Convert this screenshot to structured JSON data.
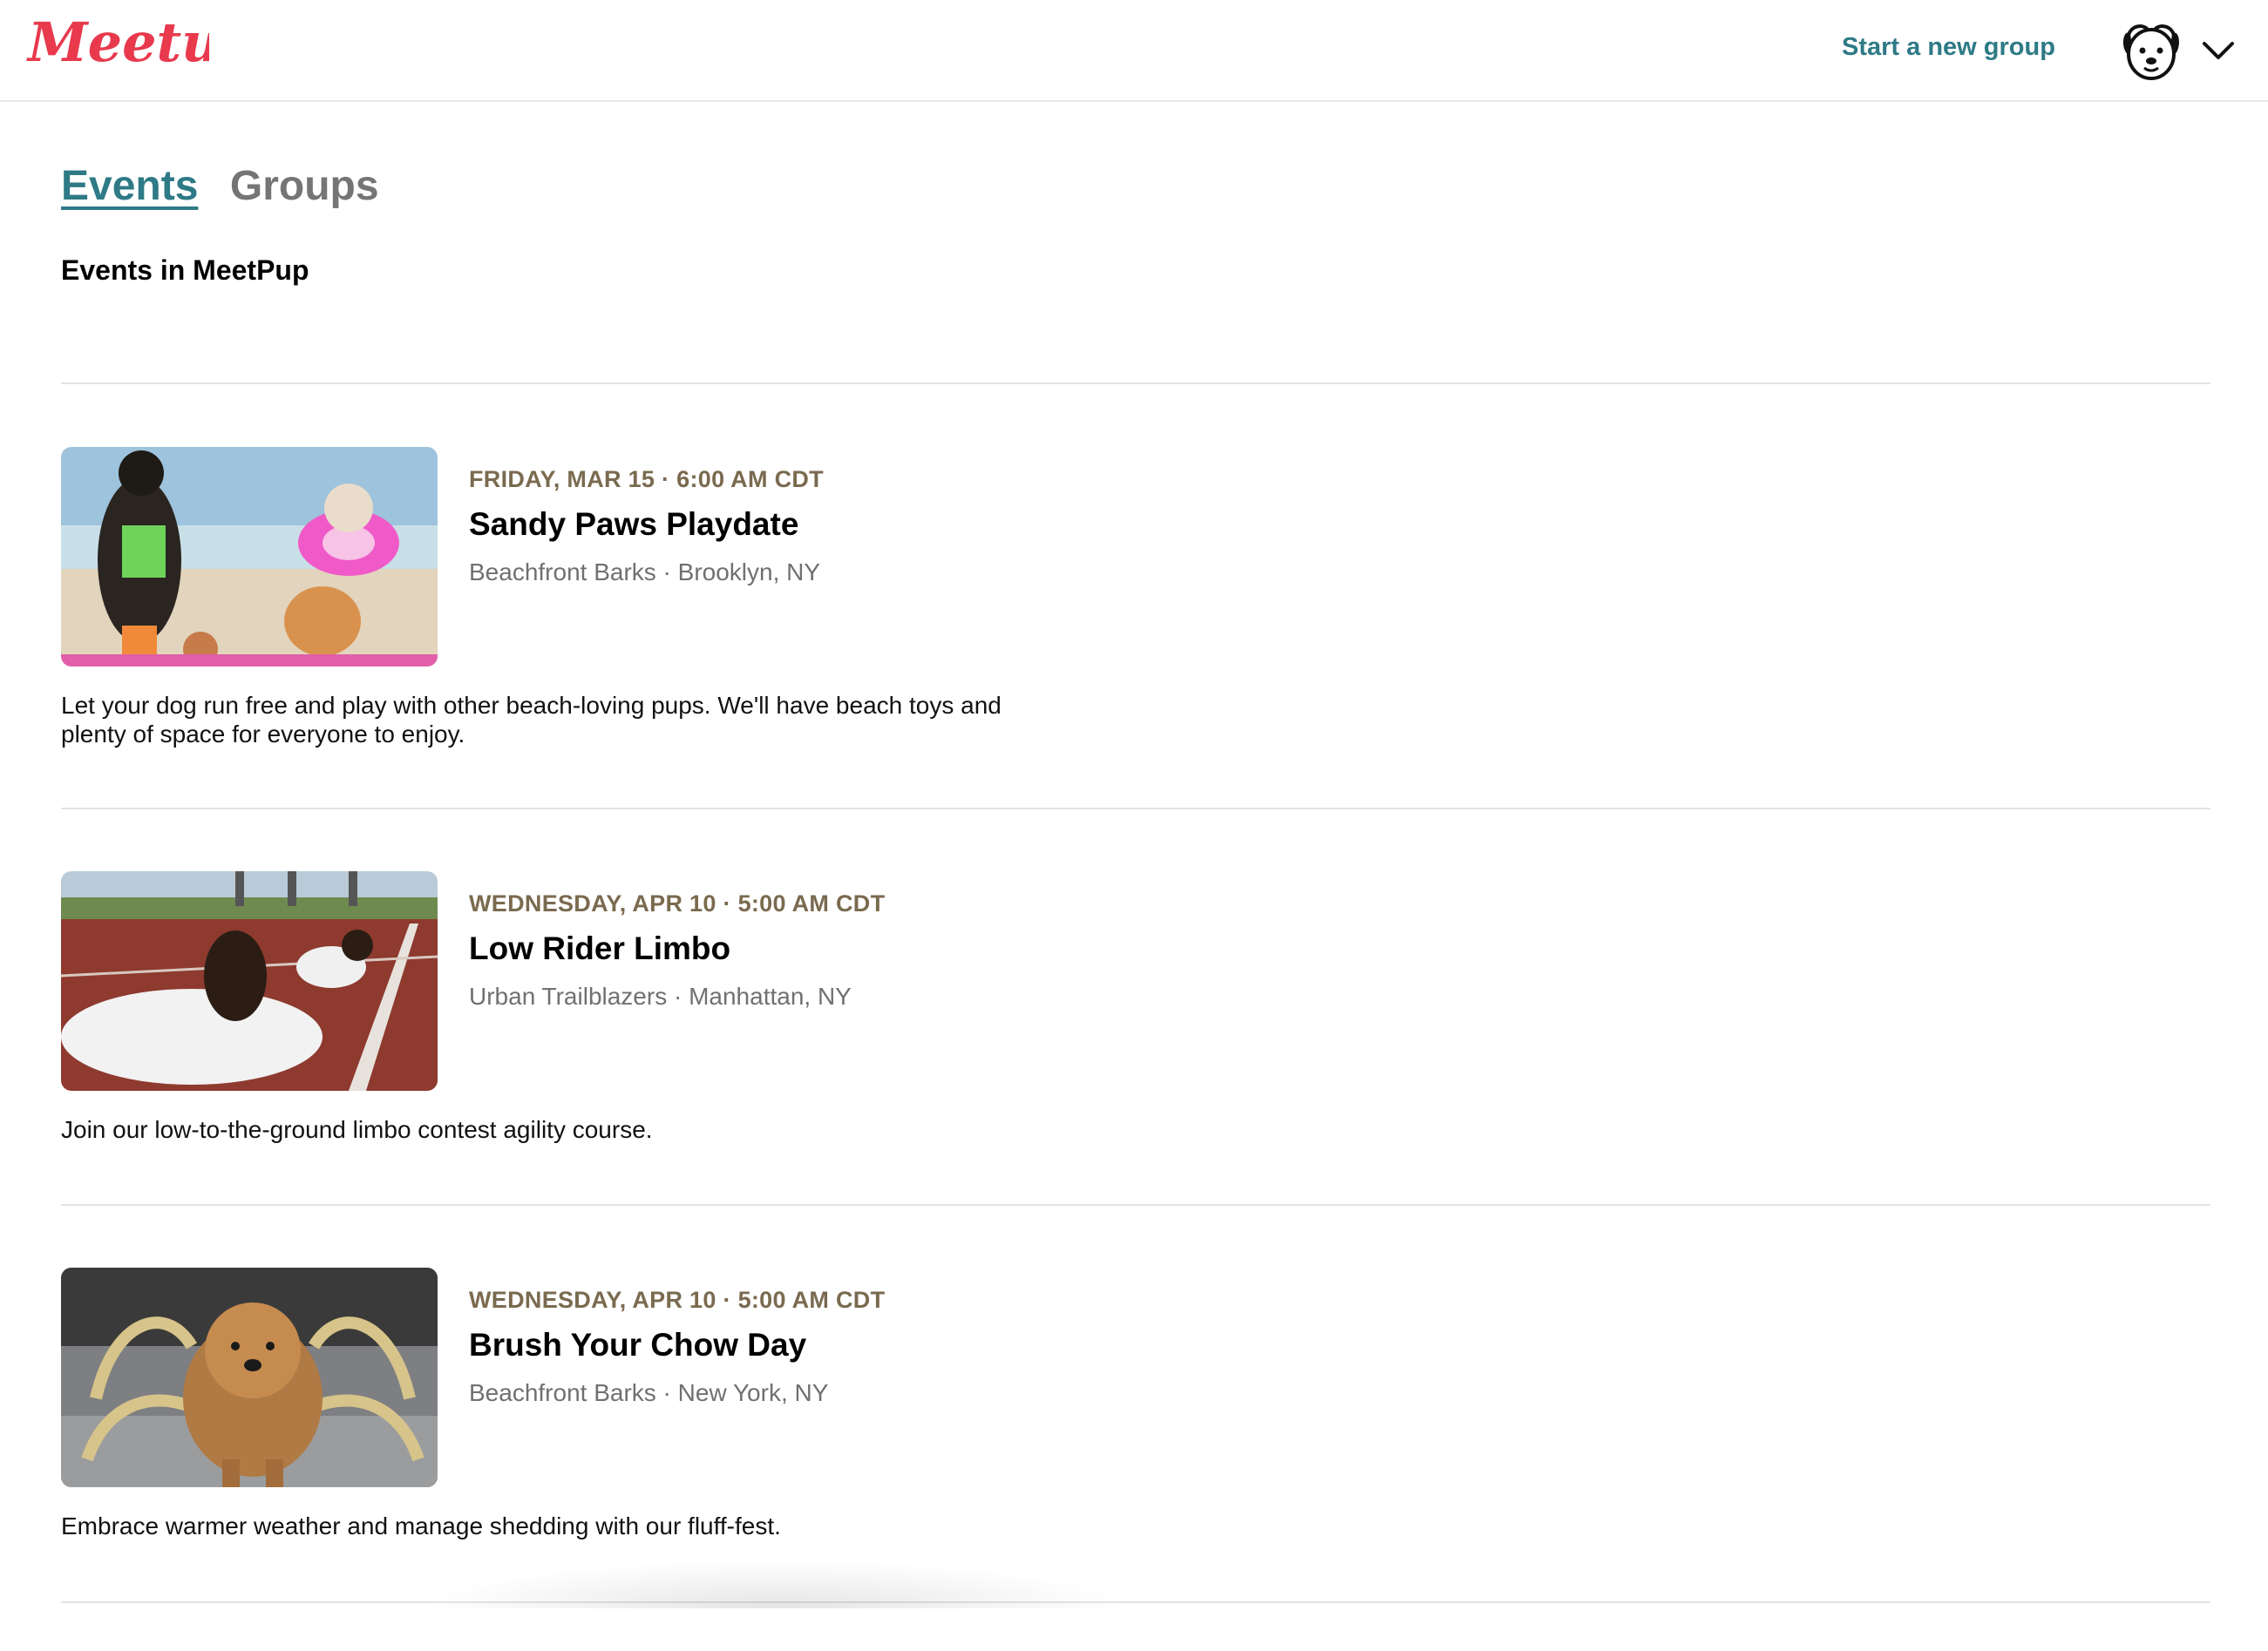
{
  "header": {
    "logo_text": "Meetup",
    "new_group_label": "Start a new group",
    "avatar_icon": "dog-face-icon",
    "menu_icon": "chevron-down-icon"
  },
  "tabs": [
    {
      "label": "Events",
      "active": true
    },
    {
      "label": "Groups",
      "active": false
    }
  ],
  "section_title": "Events in MeetPup",
  "events": [
    {
      "date": "FRIDAY, MAR 15 · 6:00 AM CDT",
      "title": "Sandy Paws Playdate",
      "location": "Beachfront Barks · Brooklyn, NY",
      "description": "Let your dog run free and play with other beach-loving pups. We'll have beach toys and plenty of space for everyone to enjoy."
    },
    {
      "date": "WEDNESDAY, APR 10 · 5:00 AM CDT",
      "title": "Low Rider Limbo",
      "location": "Urban Trailblazers · Manhattan, NY",
      "description": "Join our low-to-the-ground limbo contest agility course."
    },
    {
      "date": "WEDNESDAY, APR 10 · 5:00 AM CDT",
      "title": "Brush Your Chow Day",
      "location": "Beachfront Barks · New York, NY",
      "description": "Embrace warmer weather and manage shedding with our fluff-fest."
    }
  ],
  "colors": {
    "brand": "#e8394d",
    "accent": "#2e7a86",
    "date": "#7a6a4f",
    "muted": "#707070"
  }
}
